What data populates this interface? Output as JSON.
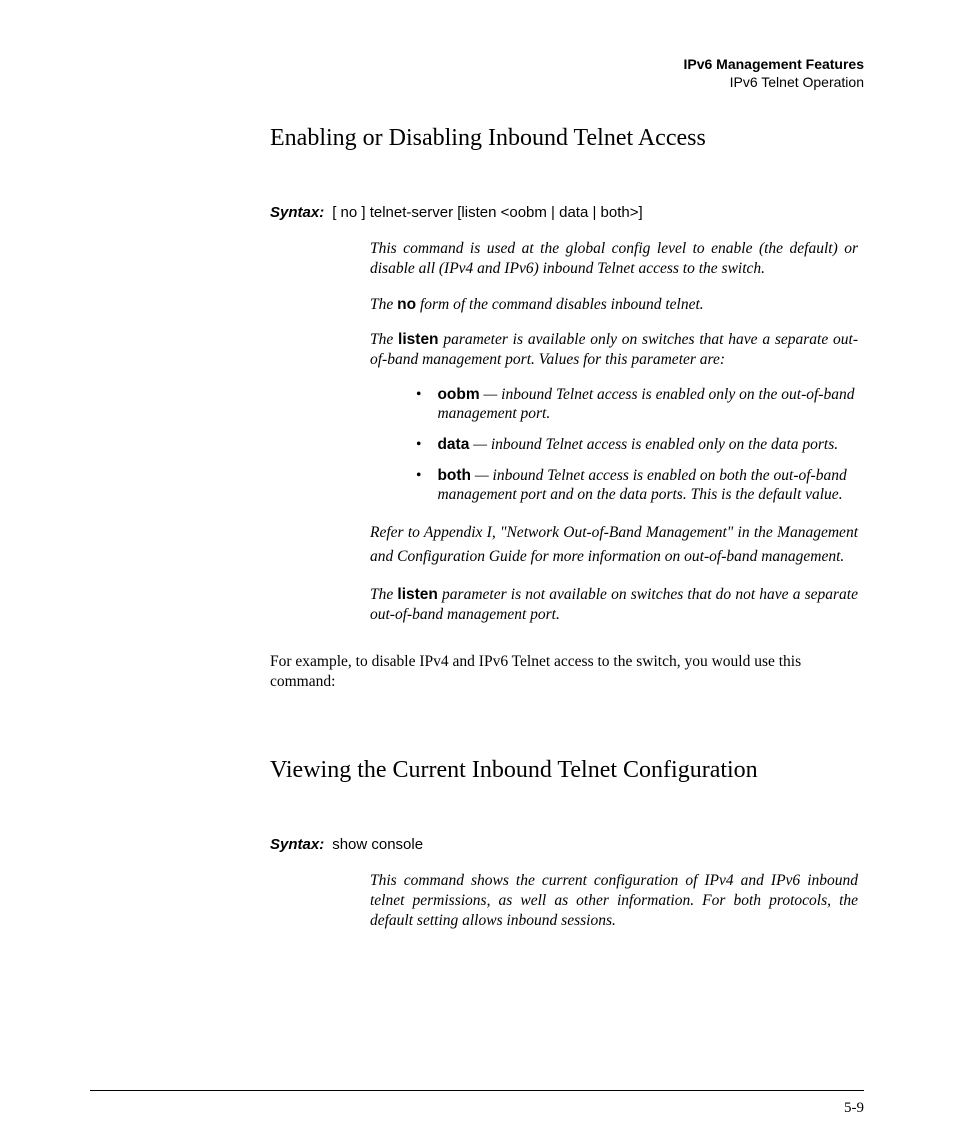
{
  "header": {
    "line1": "IPv6 Management Features",
    "line2": "IPv6 Telnet Operation"
  },
  "section1": {
    "heading": "Enabling or Disabling Inbound Telnet Access",
    "syntax_label": "Syntax:",
    "syntax_text": "[ no ] telnet-server [listen <oobm | data | both>]",
    "para1": "This command is used at the global config level to enable (the default) or disable all (IPv4 and IPv6) inbound  Telnet access to the switch.",
    "para2_pre": "The ",
    "para2_bold": "no",
    "para2_post": " form of the command disables inbound telnet.",
    "para3_pre": "The ",
    "para3_bold": "listen",
    "para3_post": " parameter is available only on switches that have a separate out-of-band management port. Values for this param­eter are:",
    "bullets": [
      {
        "bold": "oobm",
        "text": " — inbound Telnet access is enabled only on the out-of-band management port."
      },
      {
        "bold": "data",
        "text": " — inbound Telnet access is enabled only on the data ports."
      },
      {
        "bold": "both",
        "text": " — inbound Telnet access is enabled on both the out-of-band management port and on the data ports. This is the default value."
      }
    ],
    "para4": "Refer to Appendix I, \"Network Out-of-Band Management\" in the Management and Configuration Guide for more informa­tion on out-of-band management.",
    "para5_pre": "The ",
    "para5_bold": "listen",
    "para5_post": " parameter is not available on switches that do not have a separate out-of-band management port.",
    "example": "For example, to disable IPv4 and IPv6 Telnet access to the switch, you would use this command:"
  },
  "section2": {
    "heading": "Viewing the Current Inbound Telnet Configuration",
    "syntax_label": "Syntax:",
    "syntax_text": "show console",
    "para1": "This command shows the current configuration of IPv4 and IPv6 inbound telnet permissions, as well as other informa­tion. For both protocols, the default setting allows inbound sessions."
  },
  "page_number": "5-9"
}
